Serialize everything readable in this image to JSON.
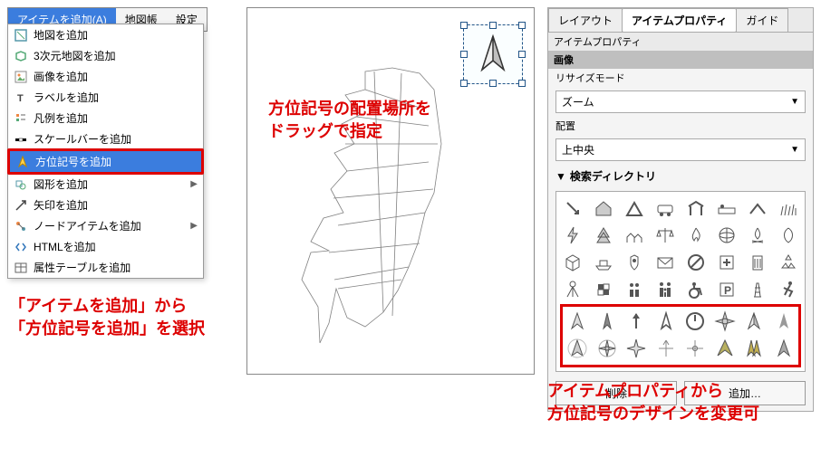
{
  "menubar": {
    "add_item": "アイテムを追加(A)",
    "atlas": "地図帳",
    "settings": "設定"
  },
  "dropdown": {
    "add_map": "地図を追加",
    "add_3d_map": "3次元地図を追加",
    "add_image": "画像を追加",
    "add_label": "ラベルを追加",
    "add_legend": "凡例を追加",
    "add_scalebar": "スケールバーを追加",
    "add_northarrow": "方位記号を追加",
    "add_shape": "図形を追加",
    "add_arrow": "矢印を追加",
    "add_node": "ノードアイテムを追加",
    "add_html": "HTMLを追加",
    "add_attrtable": "属性テーブルを追加"
  },
  "annotations": {
    "left1": "「アイテムを追加」から",
    "left2": "「方位記号を追加」を選択",
    "center1": "方位記号の配置場所を",
    "center2": "ドラッグで指定",
    "right1": "アイテムプロパティから",
    "right2": "方位記号のデザインを変更可"
  },
  "panel": {
    "tab_layout": "レイアウト",
    "tab_props": "アイテムプロパティ",
    "tab_guide": "ガイド",
    "sect_props": "アイテムプロパティ",
    "sect_image": "画像",
    "label_resize": "リサイズモード",
    "combo_zoom": "ズーム",
    "label_align": "配置",
    "combo_align": "上中央",
    "disc_search": "検索ディレクトリ",
    "btn_delete": "削除",
    "btn_add": "追加…"
  }
}
